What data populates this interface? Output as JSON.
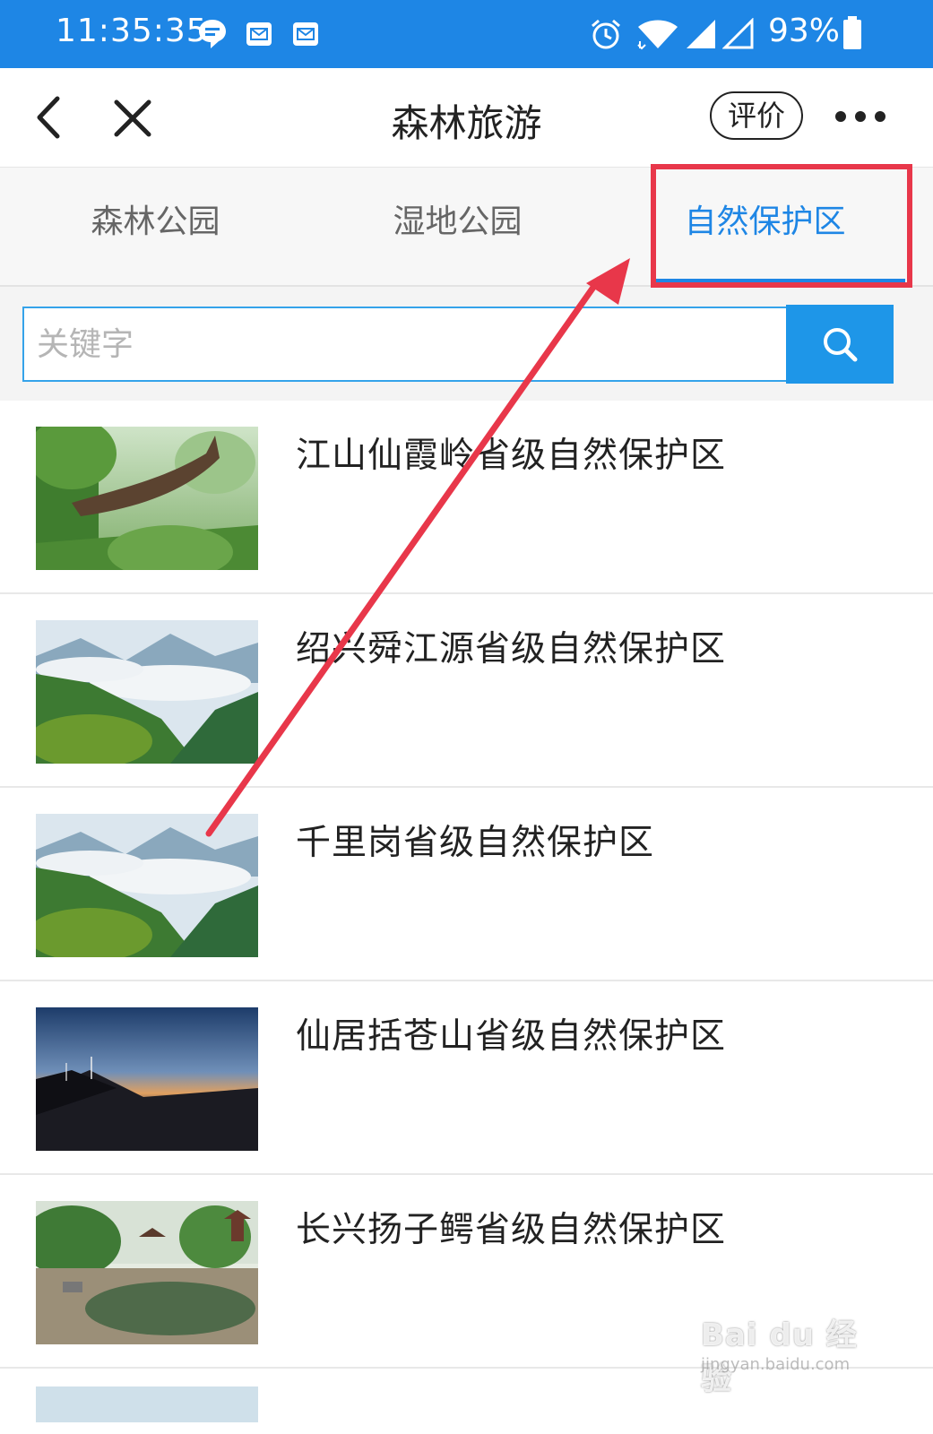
{
  "status_bar": {
    "time": "11:35:35",
    "battery": "93%",
    "icons": [
      "message-icon",
      "mail-icon",
      "mail-icon",
      "alarm-icon",
      "wifi-icon",
      "signal-icon",
      "signal-empty-icon",
      "battery-icon"
    ]
  },
  "nav": {
    "title": "森林旅游",
    "rate_label": "评价",
    "back_icon": "chevron-left-icon",
    "close_icon": "close-icon",
    "more_icon": "more-icon"
  },
  "tabs": [
    {
      "label": "森林公园",
      "active": false
    },
    {
      "label": "湿地公园",
      "active": false
    },
    {
      "label": "自然保护区",
      "active": true
    }
  ],
  "search": {
    "placeholder": "关键字",
    "value": "",
    "button_icon": "search-icon"
  },
  "list": [
    {
      "name": "江山仙霞岭省级自然保护区",
      "thumb": "forest-branch"
    },
    {
      "name": "绍兴舜江源省级自然保护区",
      "thumb": "misty-mountains"
    },
    {
      "name": "千里岗省级自然保护区",
      "thumb": "misty-mountains"
    },
    {
      "name": "仙居括苍山省级自然保护区",
      "thumb": "sunset-windmill"
    },
    {
      "name": "长兴扬子鳄省级自然保护区",
      "thumb": "pond-pagoda"
    }
  ],
  "watermark": {
    "logo": "Bai du 经验",
    "url": "jingyan.baidu.com"
  },
  "colors": {
    "accent": "#1e86e5",
    "highlight": "#e8374a",
    "status_bar": "#1e86e5"
  }
}
